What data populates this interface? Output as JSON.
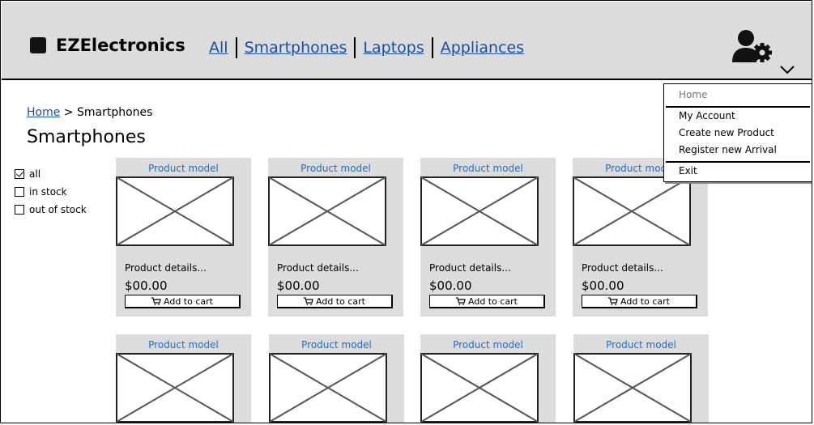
{
  "brand": "EZElectronics",
  "nav": [
    "All",
    "Smartphones",
    "Laptops",
    "Appliances"
  ],
  "breadcrumb": {
    "home": "Home",
    "sep": ">",
    "current": "Smartphones"
  },
  "page_title": "Smartphones",
  "filters": [
    {
      "label": "all",
      "checked": true
    },
    {
      "label": "in stock",
      "checked": false
    },
    {
      "label": "out of stock",
      "checked": false
    }
  ],
  "product": {
    "model": "Product model",
    "details": "Product details...",
    "price": "$00.00",
    "add_to_cart": "Add to cart"
  },
  "user_menu": {
    "home": "Home",
    "my_account": "My Account",
    "create_product": "Create new Product",
    "register_arrival": "Register new Arrival",
    "exit": "Exit"
  },
  "colors": {
    "header_bg": "#dcdcdc",
    "link": "#1a4fa0",
    "model_text": "#1a6fd0"
  }
}
